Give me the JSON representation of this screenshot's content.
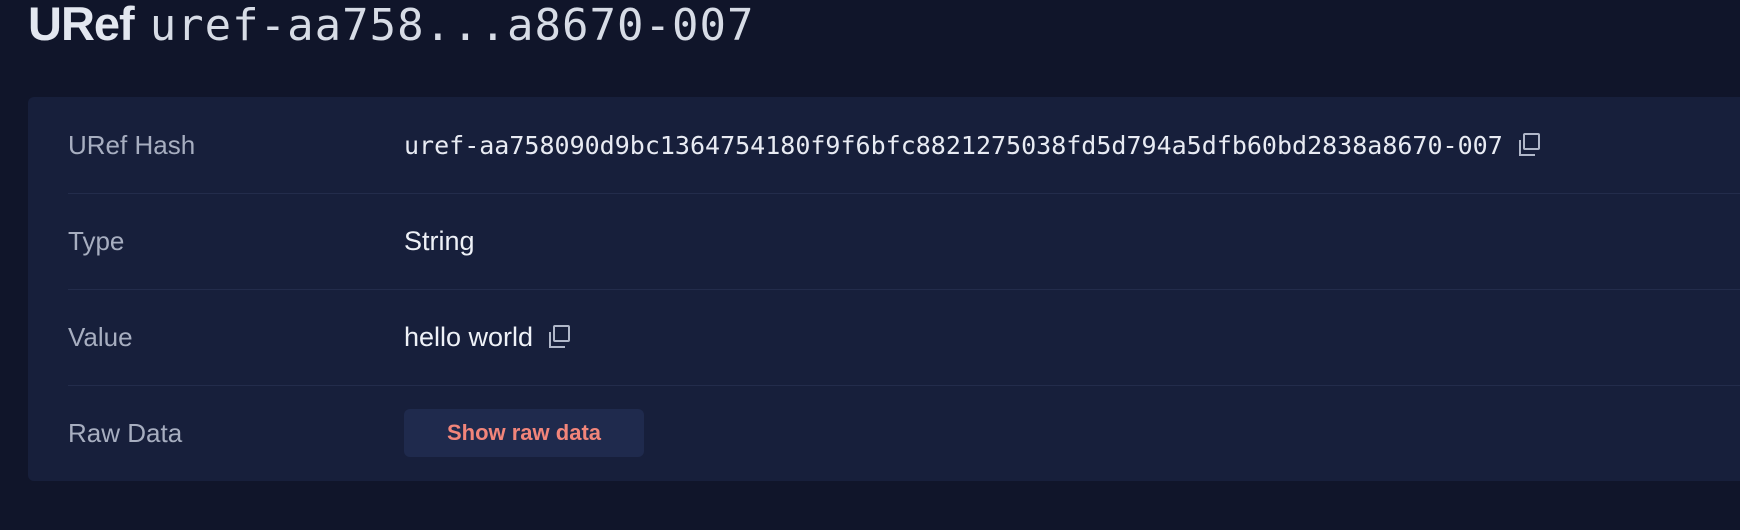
{
  "header": {
    "label": "URef",
    "short_id": "uref-aa758...a8670-007"
  },
  "details": {
    "rows": [
      {
        "label": "URef Hash",
        "value": "uref-aa758090d9bc1364754180f9f6bfc8821275038fd5d794a5dfb60bd2838a8670-007",
        "icon": "copy-icon"
      },
      {
        "label": "Type",
        "value": "String"
      },
      {
        "label": "Value",
        "value": "hello world",
        "icon": "copy-icon"
      },
      {
        "label": "Raw Data",
        "button_label": "Show raw data"
      }
    ]
  },
  "colors": {
    "background": "#10152a",
    "card": "#171f3b",
    "accent": "#f2857a",
    "button_bg": "#1f2a4d",
    "label_text": "#a7aec0"
  }
}
